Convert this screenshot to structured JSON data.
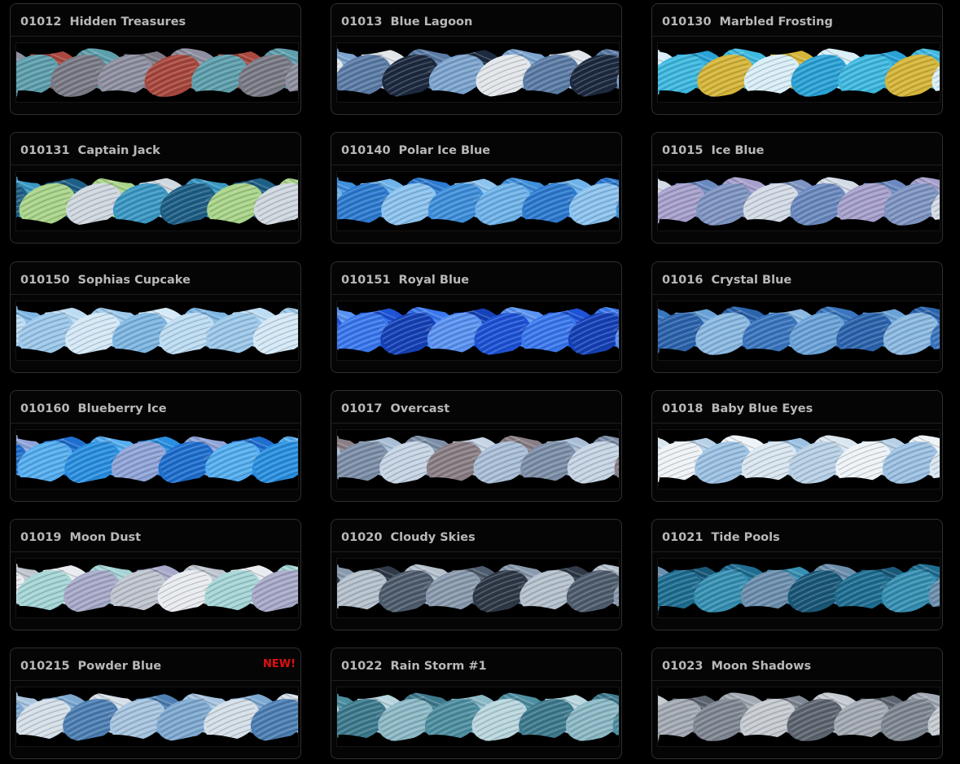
{
  "new_label": "NEW!",
  "threads": [
    {
      "code": "01012",
      "name": "Hidden Treasures",
      "colors": [
        "#8e8fa0",
        "#a8483e",
        "#5e9fad",
        "#7a7a86"
      ]
    },
    {
      "code": "01013",
      "name": "Blue Lagoon",
      "colors": [
        "#1d2a40",
        "#7da5cf",
        "#e2e6ea",
        "#5b7ca6"
      ]
    },
    {
      "code": "010130",
      "name": "Marbled Frosting",
      "colors": [
        "#3fb9e0",
        "#d5b53a",
        "#d9eef7",
        "#2aa2d6"
      ]
    },
    {
      "code": "010131",
      "name": "Captain Jack",
      "colors": [
        "#1f5f86",
        "#a9d48a",
        "#cfd7df",
        "#3b98c4"
      ]
    },
    {
      "code": "010140",
      "name": "Polar Ice Blue",
      "colors": [
        "#3f8fdb",
        "#6fb3ea",
        "#2d7bd0",
        "#8cc3ef"
      ]
    },
    {
      "code": "01015",
      "name": "Ice Blue",
      "colors": [
        "#7e95c2",
        "#d3dbe6",
        "#6a89bf",
        "#a6a0cc"
      ]
    },
    {
      "code": "010150",
      "name": "Sophias Cupcake",
      "colors": [
        "#9cc8ea",
        "#d4e8f6",
        "#7eb6e2",
        "#bcdcf2"
      ]
    },
    {
      "code": "010151",
      "name": "Royal Blue",
      "colors": [
        "#1e53d6",
        "#3a78ee",
        "#1642b8",
        "#5b93f2"
      ]
    },
    {
      "code": "01016",
      "name": "Crystal Blue",
      "colors": [
        "#3a76bf",
        "#6aa2d8",
        "#2c64ad",
        "#8bb9e2"
      ]
    },
    {
      "code": "010160",
      "name": "Blueberry Ice",
      "colors": [
        "#2a8fe0",
        "#8fa4d8",
        "#1f6fcf",
        "#55aef0"
      ]
    },
    {
      "code": "01017",
      "name": "Overcast",
      "colors": [
        "#7d8fa8",
        "#c6d4e4",
        "#8a7f86",
        "#a9bed6"
      ]
    },
    {
      "code": "01018",
      "name": "Baby Blue Eyes",
      "colors": [
        "#b8d0e6",
        "#eef3f7",
        "#9cc1e3",
        "#d9e6f0"
      ]
    },
    {
      "code": "01019",
      "name": "Moon Dust",
      "colors": [
        "#bfc5cf",
        "#e8ebef",
        "#a5d5d6",
        "#a7a9c8"
      ]
    },
    {
      "code": "01020",
      "name": "Cloudy Skies",
      "colors": [
        "#4f5d6e",
        "#8a9aae",
        "#2f3947",
        "#b5c1cd"
      ]
    },
    {
      "code": "01021",
      "name": "Tide Pools",
      "colors": [
        "#1f6e92",
        "#3790b3",
        "#6d8fae",
        "#1a5878"
      ]
    },
    {
      "code": "010215",
      "name": "Powder Blue",
      "colors": [
        "#7ea9d1",
        "#d5dfe8",
        "#4d7fb3",
        "#a7c4df"
      ],
      "is_new": true
    },
    {
      "code": "01022",
      "name": "Rain Storm #1",
      "colors": [
        "#4e8fa1",
        "#b9d6de",
        "#3e7a8e",
        "#8cb9c6"
      ]
    },
    {
      "code": "01023",
      "name": "Moon Shadows",
      "colors": [
        "#7f8792",
        "#c6cbd1",
        "#5d6570",
        "#a3aab3"
      ]
    }
  ]
}
